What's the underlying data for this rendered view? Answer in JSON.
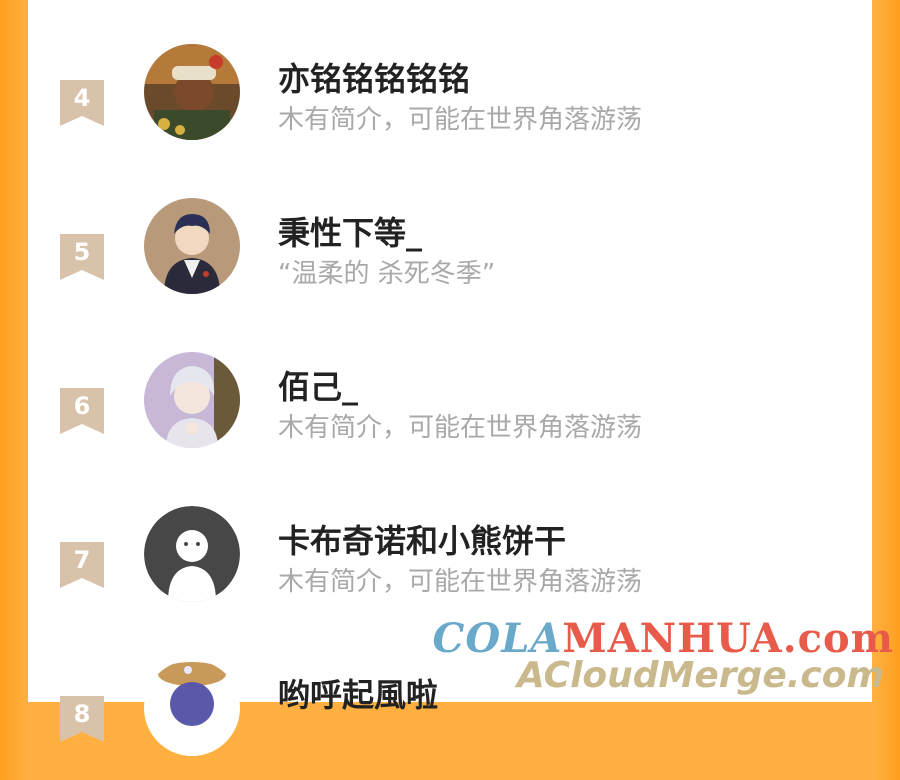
{
  "list": {
    "items": [
      {
        "rank": "4",
        "name": "亦铭铭铭铭铭",
        "bio": "木有简介，可能在世界角落游荡"
      },
      {
        "rank": "5",
        "name": "秉性下等_",
        "bio": "“温柔的 杀死冬季”"
      },
      {
        "rank": "6",
        "name": "佰己_",
        "bio": "木有简介，可能在世界角落游荡"
      },
      {
        "rank": "7",
        "name": "卡布奇诺和小熊饼干",
        "bio": "木有简介，可能在世界角落游荡"
      },
      {
        "rank": "8",
        "name": "哟呼起風啦",
        "bio": ""
      }
    ]
  },
  "watermark": {
    "line1_part1": "COLA",
    "line1_part2": "MANHUA.com",
    "line2": "ACloudMerge.com"
  },
  "colors": {
    "background_orange": "#ffb040",
    "rank_badge": "#d9c2aa",
    "name_text": "#222222",
    "bio_text": "#a9a9a9"
  }
}
